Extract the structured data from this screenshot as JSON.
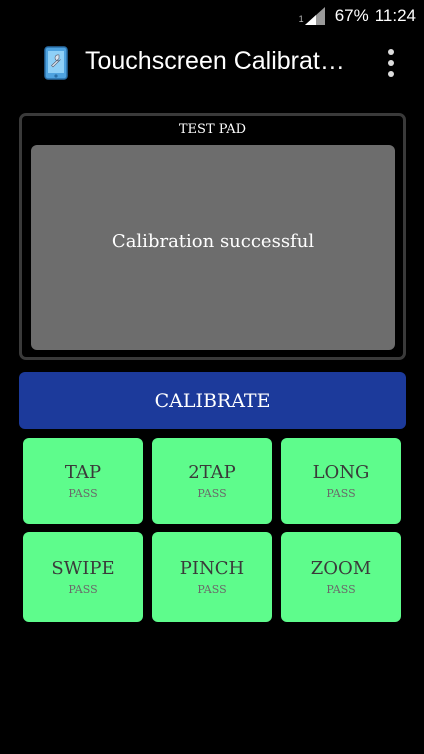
{
  "status_bar": {
    "sim_slot": "1",
    "battery": "67%",
    "time": "11:24",
    "icons": [
      "signal-icon"
    ]
  },
  "app_bar": {
    "title": "Touchscreen Calibrat…",
    "icons": [
      "app-phone-wrench-icon",
      "overflow-menu-icon"
    ]
  },
  "test_pad": {
    "label": "TEST PAD",
    "message": "Calibration successful"
  },
  "calibrate_label": "CALIBRATE",
  "gestures": [
    {
      "name": "TAP",
      "status": "PASS"
    },
    {
      "name": "2TAP",
      "status": "PASS"
    },
    {
      "name": "LONG",
      "status": "PASS"
    },
    {
      "name": "SWIPE",
      "status": "PASS"
    },
    {
      "name": "PINCH",
      "status": "PASS"
    },
    {
      "name": "ZOOM",
      "status": "PASS"
    }
  ],
  "colors": {
    "background": "#000000",
    "calibrate_button": "#1c3a9b",
    "pass_tile": "#5efc8c",
    "test_pad_area": "#6d6d6d"
  }
}
